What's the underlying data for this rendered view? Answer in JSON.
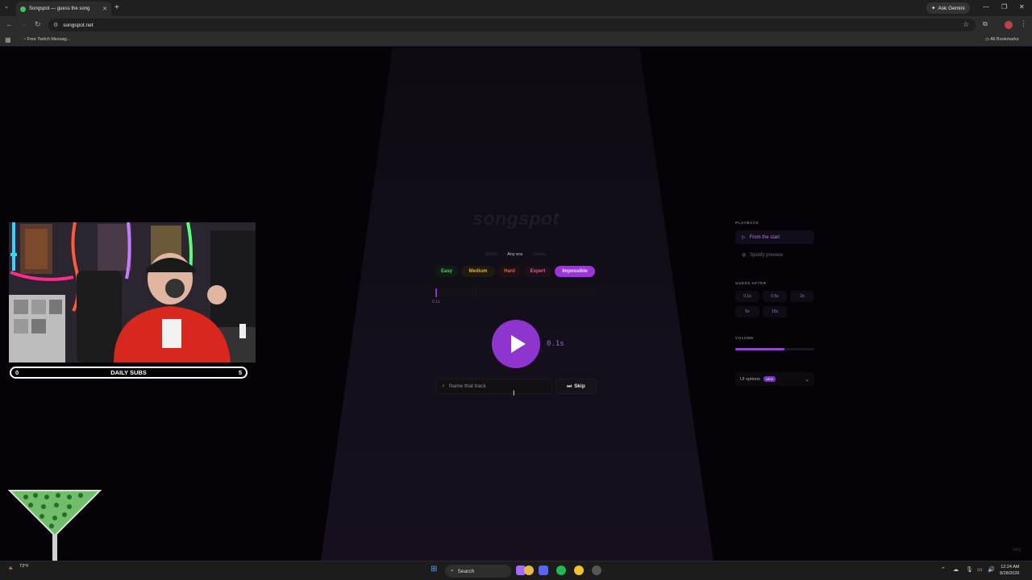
{
  "browser": {
    "tab_title": "Songspot — guess the song",
    "url": "songspot.net",
    "ask_gemini": "Ask Gemini",
    "bookmark_item": "Free Twitch Messag...",
    "all_bookmarks": "All Bookmarks"
  },
  "page": {
    "logo": "songspot",
    "eras": [
      "2020s",
      "Any era",
      "Classic"
    ],
    "selected_era": "Any era",
    "difficulties": [
      "Easy",
      "Medium",
      "Hard",
      "Expert",
      "Impossible"
    ],
    "selected_difficulty": "Impossible",
    "progress_label": "0.1s",
    "progress_fraction": 0.01,
    "play_time": "0.1s",
    "search_placeholder": "Name that track",
    "skip_label": "Skip",
    "faq": "FAQ"
  },
  "panel": {
    "playback_label": "PLAYBACK",
    "playback_options": [
      "From the start",
      "Spotify preview"
    ],
    "selected_playback": "From the start",
    "guess_after_label": "GUESS AFTER",
    "guess_after_options": [
      "0.1s",
      "0.5s",
      "2s",
      "5s",
      "15s"
    ],
    "volume_label": "VOLUME",
    "volume_fraction": 0.62,
    "ui_options_label": "UI options",
    "ui_options_badge": "NEW"
  },
  "overlay": {
    "subs_left": "0",
    "subs_title": "DAILY SUBS",
    "subs_right": "5"
  },
  "taskbar": {
    "search_label": "Search",
    "weather_temp": "73°F",
    "time": "12:24 AM",
    "date": "8/28/2026"
  },
  "colors": {
    "accent": "#9a36d7",
    "easy": "#46d26b",
    "medium": "#e5b63a",
    "hard": "#e0605a",
    "expert": "#e45a9c"
  }
}
